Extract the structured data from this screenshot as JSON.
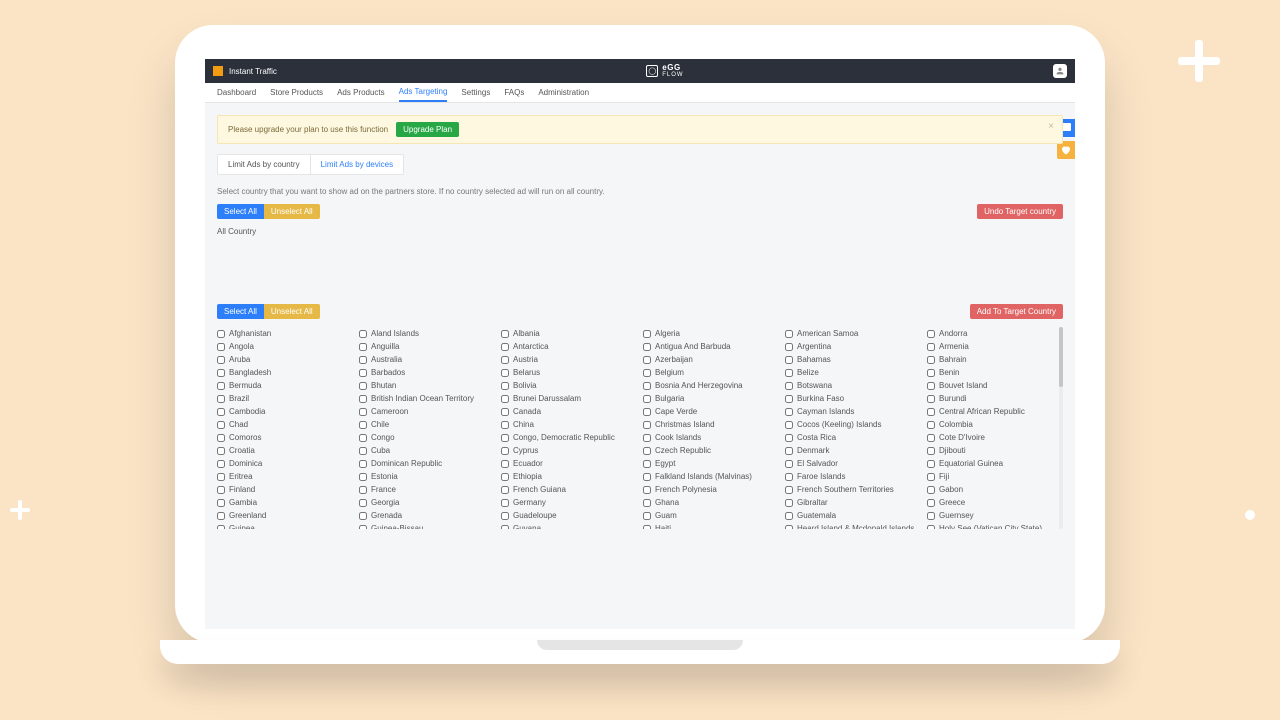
{
  "header": {
    "app_name": "Instant Traffic",
    "brand_main": "eGG",
    "brand_sub": "FLOW"
  },
  "nav": {
    "items": [
      {
        "label": "Dashboard"
      },
      {
        "label": "Store Products"
      },
      {
        "label": "Ads Products"
      },
      {
        "label": "Ads Targeting",
        "active": true
      },
      {
        "label": "Settings"
      },
      {
        "label": "FAQs"
      },
      {
        "label": "Administration"
      }
    ]
  },
  "alert": {
    "text": "Please upgrade your plan to use this function",
    "cta": "Upgrade Plan"
  },
  "limit_tabs": {
    "country": "Limit Ads by country",
    "devices": "Limit Ads by devices"
  },
  "helper": "Select country that you want to show ad on the partners store. If no country selected ad will run on all country.",
  "actions": {
    "select_all": "Select All",
    "unselect_all": "Unselect All",
    "undo_target": "Undo Target country",
    "add_to_target": "Add To Target Country"
  },
  "selected_section_label": "All Country",
  "countries_columns": [
    [
      "Afghanistan",
      "Angola",
      "Aruba",
      "Bangladesh",
      "Bermuda",
      "Brazil",
      "Cambodia",
      "Chad",
      "Comoros",
      "Croatia",
      "Dominica",
      "Eritrea",
      "Finland",
      "Gambia",
      "Greenland",
      "Guinea"
    ],
    [
      "Aland Islands",
      "Anguilla",
      "Australia",
      "Barbados",
      "Bhutan",
      "British Indian Ocean Territory",
      "Cameroon",
      "Chile",
      "Congo",
      "Cuba",
      "Dominican Republic",
      "Estonia",
      "France",
      "Georgia",
      "Grenada",
      "Guinea-Bissau"
    ],
    [
      "Albania",
      "Antarctica",
      "Austria",
      "Belarus",
      "Bolivia",
      "Brunei Darussalam",
      "Canada",
      "China",
      "Congo, Democratic Republic",
      "Cyprus",
      "Ecuador",
      "Ethiopia",
      "French Guiana",
      "Germany",
      "Guadeloupe",
      "Guyana"
    ],
    [
      "Algeria",
      "Antigua And Barbuda",
      "Azerbaijan",
      "Belgium",
      "Bosnia And Herzegovina",
      "Bulgaria",
      "Cape Verde",
      "Christmas Island",
      "Cook Islands",
      "Czech Republic",
      "Egypt",
      "Falkland Islands (Malvinas)",
      "French Polynesia",
      "Ghana",
      "Guam",
      "Haiti"
    ],
    [
      "American Samoa",
      "Argentina",
      "Bahamas",
      "Belize",
      "Botswana",
      "Burkina Faso",
      "Cayman Islands",
      "Cocos (Keeling) Islands",
      "Costa Rica",
      "Denmark",
      "El Salvador",
      "Faroe Islands",
      "French Southern Territories",
      "Gibraltar",
      "Guatemala",
      "Heard Island & Mcdonald Islands"
    ],
    [
      "Andorra",
      "Armenia",
      "Bahrain",
      "Benin",
      "Bouvet Island",
      "Burundi",
      "Central African Republic",
      "Colombia",
      "Cote D'Ivoire",
      "Djibouti",
      "Equatorial Guinea",
      "Fiji",
      "Gabon",
      "Greece",
      "Guernsey",
      "Holy See (Vatican City State)"
    ]
  ]
}
